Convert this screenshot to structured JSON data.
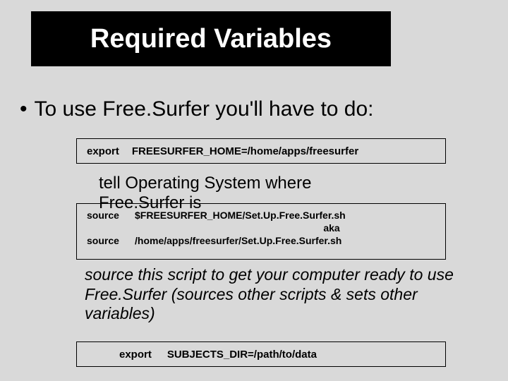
{
  "title": "Required Variables",
  "bullet": {
    "marker": "•",
    "text": "To use Free.Surfer you'll have to do:"
  },
  "box1": {
    "cmd": "export",
    "arg": "FREESURFER_HOME=/home/apps/freesurfer"
  },
  "explain1": {
    "line1": "tell Operating System where",
    "line2": "Free.Surfer is"
  },
  "box2": {
    "row1_cmd": "source",
    "row1_arg": "$FREESURFER_HOME/Set.Up.Free.Surfer.sh",
    "aka": "aka",
    "row2_cmd": "source",
    "row2_arg": "/home/apps/freesurfer/Set.Up.Free.Surfer.sh"
  },
  "explain2": "source this script to get your computer ready to use Free.Surfer (sources other scripts & sets other variables)",
  "box3": {
    "cmd": "export",
    "arg": "SUBJECTS_DIR=/path/to/data"
  }
}
